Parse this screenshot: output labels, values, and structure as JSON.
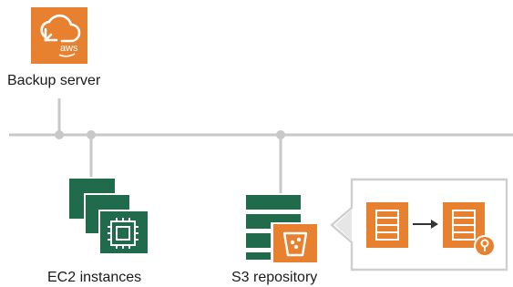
{
  "diagram": {
    "nodes": {
      "backup_server": {
        "label": "Backup server",
        "icon": "aws-cloud-icon"
      },
      "ec2_instances": {
        "label": "EC2 instances",
        "icon": "ec2-instances-icon"
      },
      "s3_repository": {
        "label": "S3 repository",
        "icon": "s3-repository-icon"
      }
    },
    "callout": {
      "icon": "offload-to-locked-storage-icon"
    }
  },
  "colors": {
    "aws_orange": "#E8812F",
    "veeam_green": "#1F6B4C",
    "veeam_green_dark": "#0F4F36",
    "connector_gray": "#C8C8C8",
    "callout_border": "#CFCFCF",
    "text": "#1A1A1A"
  }
}
